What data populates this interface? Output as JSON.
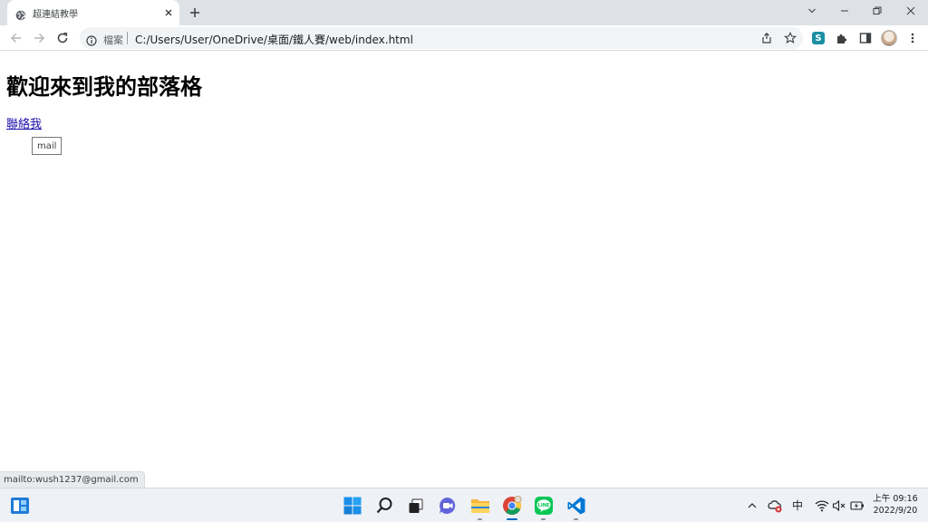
{
  "browser": {
    "tab": {
      "title": "超連結教學",
      "favicon": "globe-icon",
      "close_icon": "close-icon"
    },
    "new_tab_icon": "plus-icon",
    "window_controls": [
      "chevron-down-icon",
      "minimize-icon",
      "restore-icon",
      "close-icon"
    ],
    "toolbar": {
      "back_icon": "arrow-left-icon",
      "forward_icon": "arrow-right-icon",
      "reload_icon": "reload-icon",
      "omnibox": {
        "info_icon": "info-icon",
        "scheme_label": "檔案",
        "url": "C:/Users/User/OneDrive/桌面/鐵人賽/web/index.html"
      },
      "actions": [
        "share-icon",
        "star-icon"
      ],
      "extensions": [
        {
          "name": "s-extension-icon",
          "label": "S",
          "color": "#1a8fa3"
        },
        {
          "name": "puzzle-icon"
        },
        {
          "name": "side-panel-icon"
        },
        {
          "name": "profile-avatar"
        },
        {
          "name": "more-vertical-icon"
        }
      ]
    }
  },
  "page": {
    "heading": "歡迎來到我的部落格",
    "contact_link": "聯絡我",
    "tooltip": "mail",
    "status_url": "mailto:wush1237@gmail.com"
  },
  "taskbar": {
    "widgets_icon": "widgets-icon",
    "apps": [
      {
        "name": "start-icon"
      },
      {
        "name": "search-icon"
      },
      {
        "name": "task-view-icon"
      },
      {
        "name": "teams-chat-icon"
      },
      {
        "name": "file-explorer-icon",
        "running": true
      },
      {
        "name": "chrome-icon",
        "running": true,
        "active": true
      },
      {
        "name": "line-icon",
        "running": true,
        "label": "LINE"
      },
      {
        "name": "vscode-icon",
        "running": true
      }
    ],
    "tray": {
      "icons": [
        "chevron-up-icon",
        "onedrive-error-icon",
        "wifi-icon",
        "speaker-muted-icon",
        "battery-icon"
      ],
      "ime": "中",
      "time": "上午 09:16",
      "date": "2022/9/20"
    }
  },
  "colors": {
    "link": "#1a0dab",
    "accent": "#0067c0",
    "tabstrip": "#dee1e6"
  }
}
